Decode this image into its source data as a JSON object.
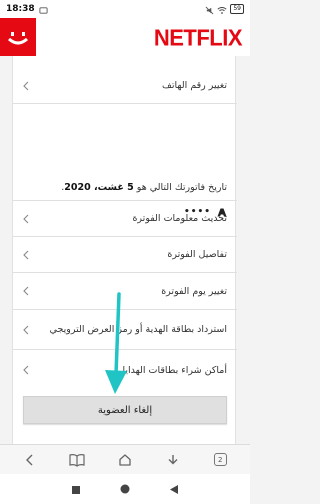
{
  "status_bar": {
    "time": "18:38",
    "battery": "59"
  },
  "header": {
    "logo": "NETFLIX"
  },
  "account": {
    "change_phone_label": "تغيير رقم الهاتف",
    "billing_prefix": "تاريخ فاتورتك التالي هو",
    "billing_date": "5 غشت، 2020",
    "billing_suffix": ".",
    "card_masked": "••••",
    "card_brand_icon": "card-brand-icon",
    "menu": [
      {
        "label": "تحديث معلومات الفوترة"
      },
      {
        "label": "تفاصيل الفوترة"
      },
      {
        "label": "تغيير يوم الفوترة"
      },
      {
        "label": "استرداد بطاقة الهدية أو رمز العرض الترويجي"
      },
      {
        "label": "أماكن شراء بطاقات الهدايا"
      }
    ],
    "cancel_label": "إلغاء العضوية"
  },
  "browser_bar": {
    "tab_count": "2"
  },
  "colors": {
    "netflix_red": "#e50914",
    "arrow": "#21c4c4"
  }
}
